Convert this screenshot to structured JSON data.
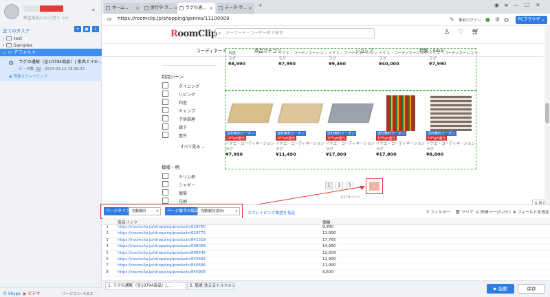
{
  "left": {
    "upgrade_label": "料金を払い上に行く >>",
    "all_tasks_label": "全てのタスク",
    "folders": [
      "test",
      "Samples"
    ],
    "group_label": "デフォルト",
    "task": {
      "title": "ラグの通販（全10794商品）| 家具とイン...",
      "data_label": "データ数:",
      "data_count": "82",
      "timestamp": "2024-03-12 15:38:37",
      "status": "簡易スクレイピング"
    },
    "bottom": {
      "skype": "Skype",
      "video": "ビデオ",
      "version": "バージョン: 4.0.2"
    }
  },
  "browser": {
    "tabs": [
      "ホーム...",
      "実行中-ラ...",
      "ラグの通...",
      "データ-ラ..."
    ],
    "active_tab": 2,
    "url": "https://roomclip.jp/shopping/genres/11100009",
    "login_label": "事前ログイン",
    "mode_label": "PCブラウザ"
  },
  "site": {
    "logo_a": "R",
    "logo_b": "oomClip",
    "search_placeholder": "キーワード・ユーザー名で探す",
    "menu": [
      "コーディネート",
      "商品カテゴリ",
      "ショップ",
      "特集・SALE"
    ]
  },
  "filters": {
    "scene_title": "利用シーン",
    "scene_items": [
      "ダイニング",
      "リビング",
      "和室",
      "キャンプ",
      "子供部屋",
      "廊下",
      "屋外"
    ],
    "more_label": "すべて見る",
    "pattern_title": "模様・柄",
    "pattern_items": [
      "キリム柄",
      "シャギー",
      "葡萄",
      "花柄"
    ]
  },
  "products_top": [
    {
      "brand": "日景",
      "sub": "ラグ",
      "price": "¥8,990"
    },
    {
      "brand": "イケエ・コーディネーション",
      "sub": "ラグ",
      "price": "¥7,990"
    },
    {
      "brand": "イケエ・コーディネーション",
      "sub": "ラグ",
      "price": "¥9,460"
    },
    {
      "brand": "イケエ・コーディネーション",
      "sub": "ラグ",
      "price": "¥40,000"
    },
    {
      "brand": "イケエ・コーディネーション",
      "sub": "ラグ",
      "price": "¥7,990"
    }
  ],
  "products_bottom": [
    {
      "badge1": "送料無料クーポン",
      "badge2": "10%pt還元",
      "brand": "イケエ・コーディネーション",
      "sub": "ラグ",
      "price": "¥7,990",
      "color": "#d8c08c"
    },
    {
      "badge1": "送料無料クーポン",
      "badge2": "10%pt還元",
      "brand": "イケエ・コーディネーション",
      "sub": "ラグ",
      "price": "¥11,490",
      "color": "#dcc69a"
    },
    {
      "badge1": "送料無料クーポン",
      "badge2": "10%pt還元",
      "brand": "イケエ・コーディネーション",
      "sub": "ラグ",
      "price": "¥17,800",
      "color": "#9aa2ac"
    },
    {
      "badge1": "送料無料クーポン",
      "badge2": "10%pt還元",
      "brand": "イケエ・コーディネーション",
      "sub": "ラグ",
      "price": "¥17,800",
      "color": "#b8262a"
    },
    {
      "badge1": "送料無料クーポン",
      "badge2": "10%pt還元",
      "brand": "イケエ・コーディネーション",
      "sub": "ラグ",
      "price": "¥8,800",
      "color": "#7a6e62"
    }
  ],
  "pagination": {
    "pages": [
      "1",
      "2",
      "3"
    ],
    "count": "1/179ページ",
    "fold_label": "折る"
  },
  "toolbar": {
    "page_type_label": "ページタイプ",
    "page_type_value": "自動識別",
    "paging_label": "ページ番号の設定",
    "paging_value": "自動識別(成功)",
    "clear_link": "スクレイピング範囲を指定",
    "filter": "フィルター",
    "clear": "クリア",
    "detail": "詳細ページに行く",
    "add_field": "フィールドを追加"
  },
  "table": {
    "headers": [
      "商品リンク",
      "価格"
    ],
    "rows": [
      {
        "n": "1",
        "link": "https://roomclip.jp/shopping/products/628760",
        "price": "8,990"
      },
      {
        "n": "2",
        "link": "https://roomclip.jp/shopping/products/628772",
        "price": "11,990"
      },
      {
        "n": "3",
        "link": "https://roomclip.jp/shopping/products/842319",
        "price": "17,765"
      },
      {
        "n": "4",
        "link": "https://roomclip.jp/shopping/products/698009",
        "price": "14,990"
      },
      {
        "n": "5",
        "link": "https://roomclip.jp/shopping/products/898545",
        "price": "12,509"
      },
      {
        "n": "6",
        "link": "https://roomclip.jp/shopping/products/840695",
        "price": "11,990"
      },
      {
        "n": "7",
        "link": "https://roomclip.jp/shopping/products/840696",
        "price": "11,990"
      },
      {
        "n": "8",
        "link": "https://roomclip.jp/shopping/products/840905",
        "price": "6,600"
      }
    ]
  },
  "bottom_tabs": [
    "1. ラグの通販（全10794商品）|...",
    "2. 肌原 洗えるトルクメン風ラグ..."
  ],
  "actions": {
    "run": "起動",
    "save": "保存"
  }
}
